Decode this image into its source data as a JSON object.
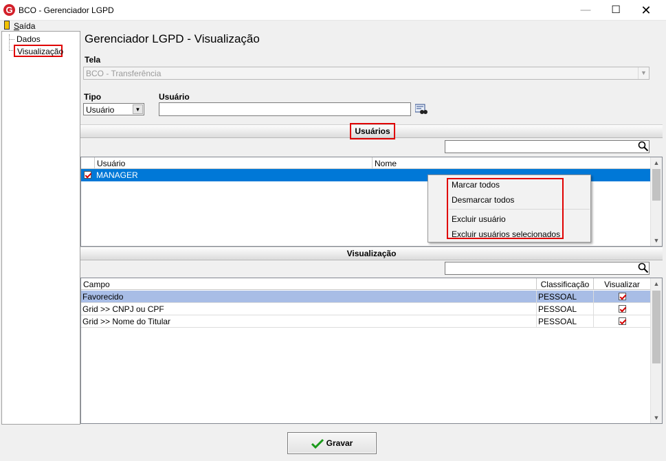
{
  "window": {
    "title": "BCO - Gerenciador LGPD",
    "logo_letter": "G",
    "minimize_glyph": "—",
    "maximize_glyph": "☐",
    "close_glyph": "✕"
  },
  "menu": {
    "exit_label": "Saída"
  },
  "tree": {
    "items": [
      {
        "label": "Dados"
      },
      {
        "label": "Visualização",
        "selected": true
      }
    ]
  },
  "header": {
    "title": "Gerenciador LGPD - Visualização"
  },
  "form": {
    "tela_label": "Tela",
    "tela_value": "BCO - Transferência",
    "tipo_label": "Tipo",
    "tipo_value": "Usuário",
    "usuario_label": "Usuário",
    "usuario_value": ""
  },
  "usuarios_section": {
    "title": "Usuários",
    "search_value": "",
    "columns": [
      "Usuário",
      "Nome"
    ],
    "rows": [
      {
        "checked": true,
        "usuario": "MANAGER",
        "nome": ""
      }
    ]
  },
  "context_menu": {
    "items": [
      "Marcar todos",
      "Desmarcar todos",
      "Excluir usuário",
      "Excluir usuários selecionados"
    ]
  },
  "visualizacao_section": {
    "title": "Visualização",
    "search_value": "",
    "columns": [
      "Campo",
      "Classificação",
      "Visualizar"
    ],
    "rows": [
      {
        "campo": "Favorecido",
        "classificacao": "PESSOAL",
        "visualizar": true
      },
      {
        "campo": "Grid >> CNPJ ou CPF",
        "classificacao": "PESSOAL",
        "visualizar": true
      },
      {
        "campo": "Grid >> Nome do Titular",
        "classificacao": "PESSOAL",
        "visualizar": true
      }
    ]
  },
  "footer": {
    "save_label": "Gravar"
  },
  "icons": [
    "app-logo-icon",
    "exit-door-icon",
    "binoculars-icon",
    "search-icon",
    "check-icon",
    "chevron-down-icon"
  ],
  "colors": {
    "highlight_outline": "#e00000",
    "selected_row": "#0078d7",
    "selected_row_visual": "#a8bde6",
    "logo": "#d3202a",
    "check": "#d40000",
    "save_check": "#1a9a1a"
  }
}
